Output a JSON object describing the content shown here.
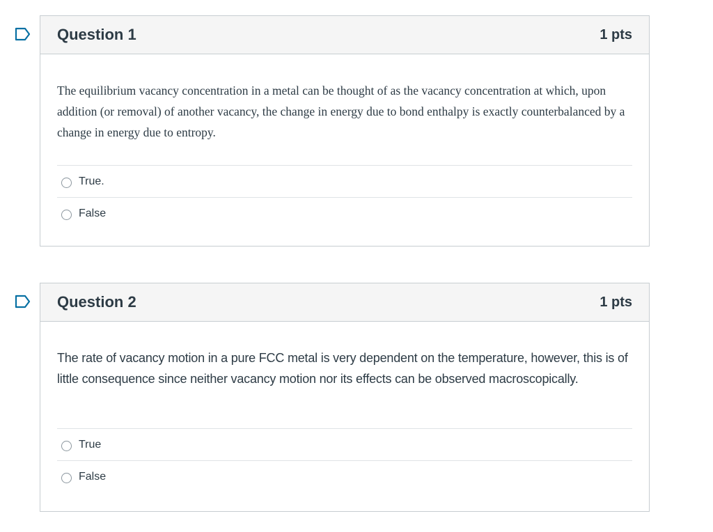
{
  "questions": [
    {
      "title": "Question 1",
      "points": "1 pts",
      "text": "The equilibrium vacancy concentration in a metal can be thought of as the vacancy concentration at which, upon addition (or removal) of another vacancy, the change in energy due to bond enthalpy is exactly counterbalanced by a change in energy due to entropy.",
      "answers": [
        {
          "label": "True."
        },
        {
          "label": "False"
        }
      ]
    },
    {
      "title": "Question 2",
      "points": "1 pts",
      "text": "The rate of vacancy motion in a pure FCC metal is very dependent on the temperature, however, this is of little consequence since neither vacancy motion nor its effects can be observed macroscopically.",
      "answers": [
        {
          "label": "True"
        },
        {
          "label": "False"
        }
      ]
    }
  ],
  "icons": {
    "flag": "bookmark-flag-icon",
    "radio": "radio-button-icon"
  },
  "colors": {
    "flag": "#0770a3",
    "text": "#2d3b45",
    "border": "#c7cdd1",
    "header_bg": "#f5f5f5"
  }
}
